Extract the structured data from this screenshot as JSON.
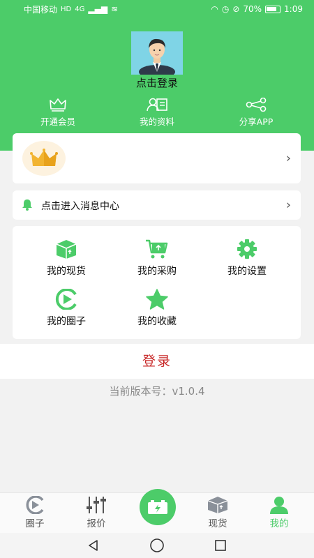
{
  "status": {
    "carrier": "中国移动",
    "hd": "HD",
    "net": "4G",
    "battery": "70%",
    "time": "1:09"
  },
  "profile": {
    "login_hint": "点击登录"
  },
  "quick_actions": [
    {
      "label": "开通会员",
      "icon": "crown-outline-icon"
    },
    {
      "label": "我的资料",
      "icon": "profile-card-icon"
    },
    {
      "label": "分享APP",
      "icon": "share-icon"
    }
  ],
  "vip_card": {
    "icon": "gold-crown-icon"
  },
  "message": {
    "label": "点击进入消息中心",
    "icon": "bell-icon"
  },
  "grid": [
    {
      "label": "我的现货",
      "icon": "box-icon"
    },
    {
      "label": "我的采购",
      "icon": "cart-icon"
    },
    {
      "label": "我的设置",
      "icon": "gear-icon"
    },
    {
      "label": "我的圈子",
      "icon": "circle-play-icon"
    },
    {
      "label": "我的收藏",
      "icon": "star-icon"
    }
  ],
  "login_button": "登录",
  "version": "当前版本号：v1.0.4",
  "tabs": [
    {
      "label": "圈子",
      "active": false
    },
    {
      "label": "报价",
      "active": false
    },
    {
      "label": "",
      "active": false
    },
    {
      "label": "现货",
      "active": false
    },
    {
      "label": "我的",
      "active": true
    }
  ],
  "colors": {
    "brand": "#4ccc69",
    "login_text": "#c82828"
  }
}
